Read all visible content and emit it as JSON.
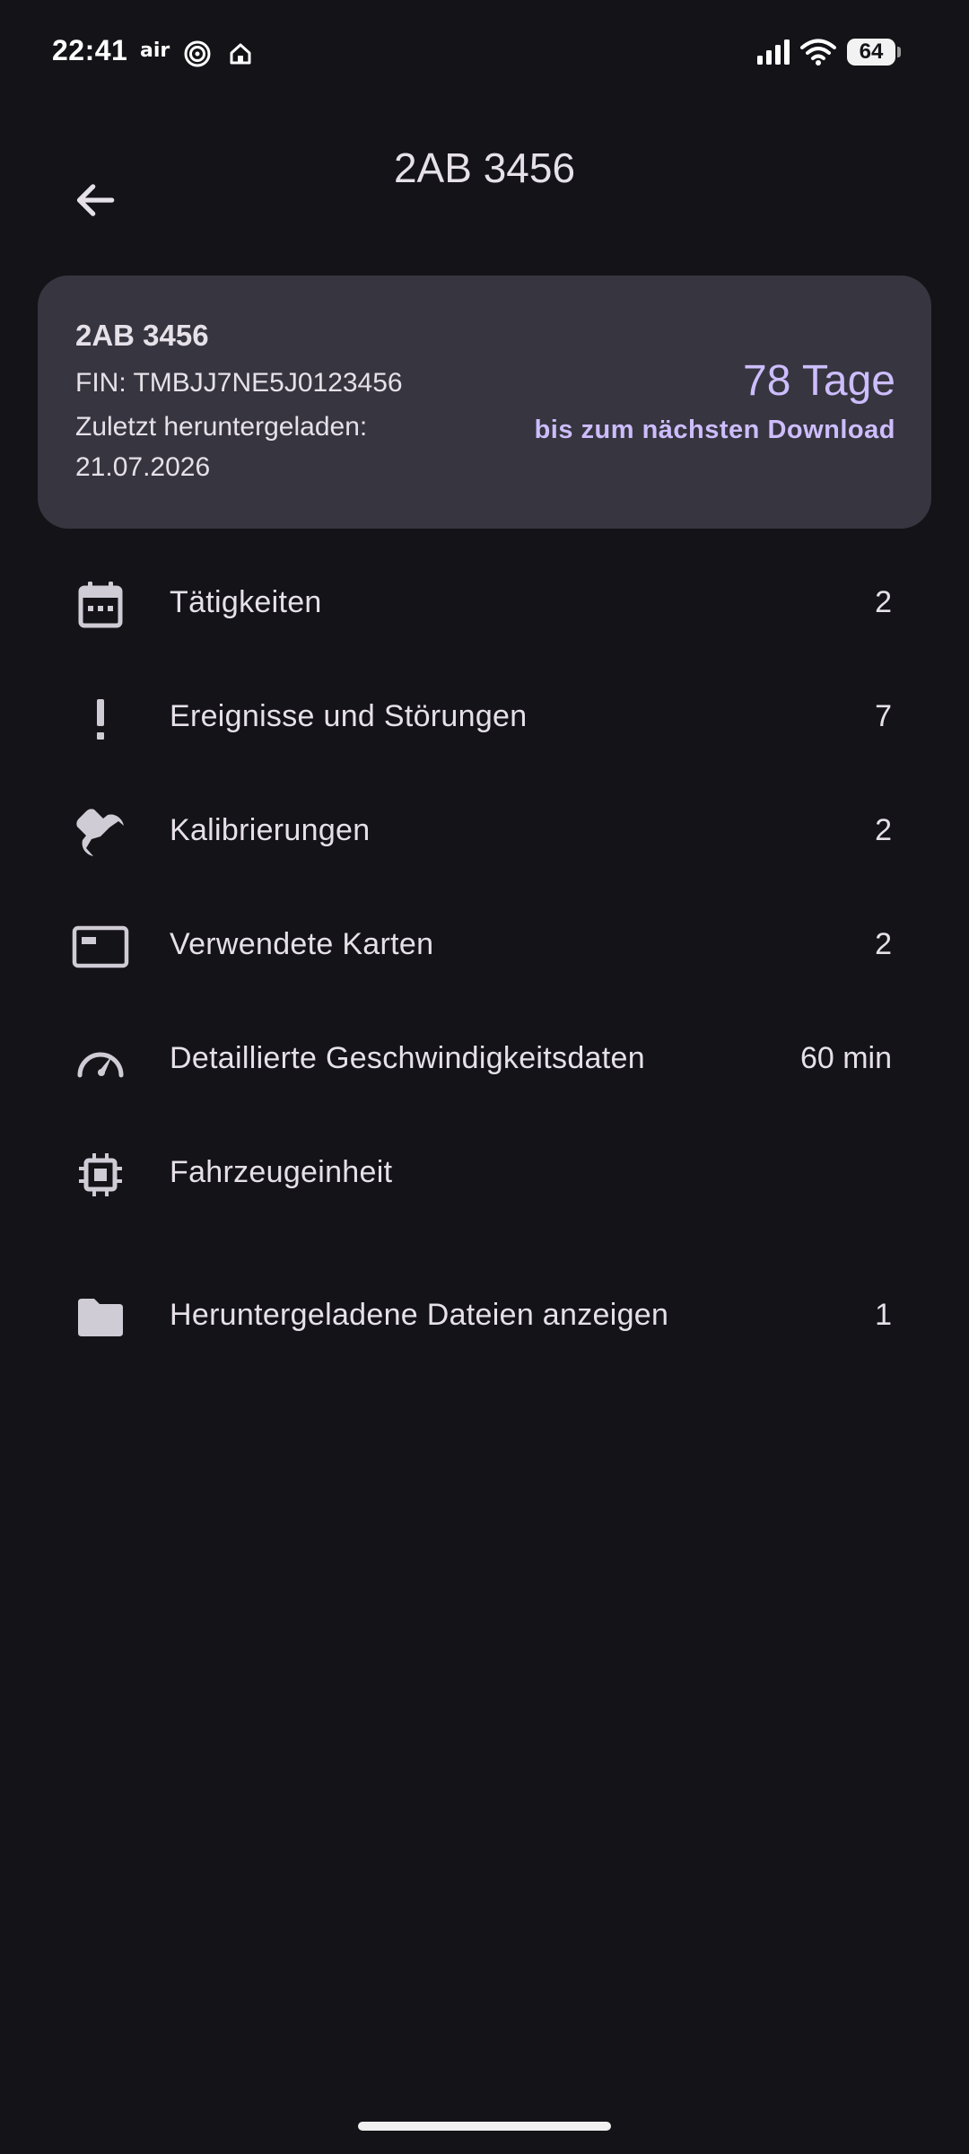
{
  "status_bar": {
    "time": "22:41",
    "air_label": "air",
    "battery": "64",
    "icons": [
      "air-icon",
      "hotspot-icon",
      "home-icon",
      "signal-icon",
      "wifi-icon",
      "battery-icon"
    ]
  },
  "app_bar": {
    "title": "2AB 3456",
    "back_icon": "arrow-back-icon"
  },
  "vehicle_card": {
    "plate": "2AB 3456",
    "fin": "FIN: TMBJJ7NE5J0123456",
    "last_download_label": "Zuletzt heruntergeladen:",
    "last_download_date": "21.07.2026",
    "days": "78 Tage",
    "days_subtitle": "bis zum nächsten Download"
  },
  "menu": {
    "items": [
      {
        "icon": "calendar-icon",
        "label": "Tätigkeiten",
        "count": "2"
      },
      {
        "icon": "exclamation-icon",
        "label": "Ereignisse und Störungen",
        "count": "7"
      },
      {
        "icon": "wrench-icon",
        "label": "Kalibrierungen",
        "count": "2"
      },
      {
        "icon": "card-icon",
        "label": "Verwendete Karten",
        "count": "2"
      },
      {
        "icon": "speedometer-icon",
        "label": "Detaillierte Geschwindigkeitsdaten",
        "count": "60 min"
      },
      {
        "icon": "chip-icon",
        "label": "Fahrzeugeinheit",
        "count": ""
      },
      {
        "icon": "folder-icon",
        "label": "Heruntergeladene Dateien anzeigen",
        "count": "1"
      }
    ]
  },
  "colors": {
    "background": "#141318",
    "card": "#37353f",
    "accent": "#cdbdfd",
    "text": "#e6e1e9",
    "icon": "#d0ccd6"
  }
}
